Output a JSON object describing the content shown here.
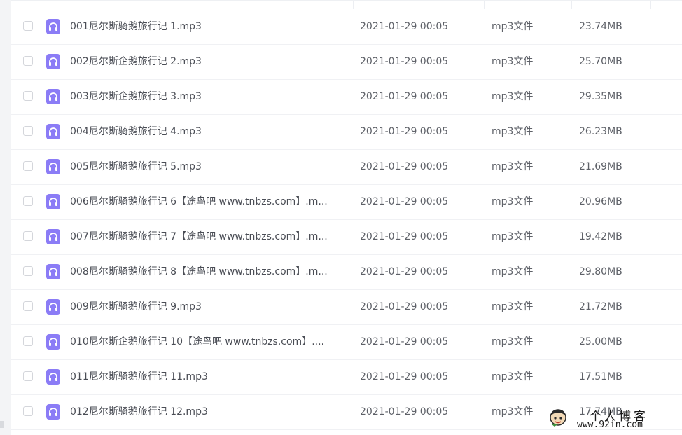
{
  "files": [
    {
      "name": "001尼尔斯骑鹅旅行记 1.mp3",
      "date": "2021-01-29 00:05",
      "type": "mp3文件",
      "size": "23.74MB"
    },
    {
      "name": "002尼尔斯企鹅旅行记 2.mp3",
      "date": "2021-01-29 00:05",
      "type": "mp3文件",
      "size": "25.70MB"
    },
    {
      "name": "003尼尔斯企鹅旅行记 3.mp3",
      "date": "2021-01-29 00:05",
      "type": "mp3文件",
      "size": "29.35MB"
    },
    {
      "name": "004尼尔斯骑鹅旅行记 4.mp3",
      "date": "2021-01-29 00:05",
      "type": "mp3文件",
      "size": "26.23MB"
    },
    {
      "name": "005尼尔斯骑鹅旅行记 5.mp3",
      "date": "2021-01-29 00:05",
      "type": "mp3文件",
      "size": "21.69MB"
    },
    {
      "name": "006尼尔斯骑鹅旅行记 6【途鸟吧 www.tnbzs.com】.m...",
      "date": "2021-01-29 00:05",
      "type": "mp3文件",
      "size": "20.96MB"
    },
    {
      "name": "007尼尔斯骑鹅旅行记 7【途鸟吧 www.tnbzs.com】.m...",
      "date": "2021-01-29 00:05",
      "type": "mp3文件",
      "size": "19.42MB"
    },
    {
      "name": "008尼尔斯骑鹅旅行记 8【途鸟吧 www.tnbzs.com】.m...",
      "date": "2021-01-29 00:05",
      "type": "mp3文件",
      "size": "29.80MB"
    },
    {
      "name": "009尼尔斯骑鹅旅行记 9.mp3",
      "date": "2021-01-29 00:05",
      "type": "mp3文件",
      "size": "21.72MB"
    },
    {
      "name": "010尼尔斯企鹅旅行记 10【途鸟吧 www.tnbzs.com】....",
      "date": "2021-01-29 00:05",
      "type": "mp3文件",
      "size": "25.00MB"
    },
    {
      "name": "011尼尔斯骑鹅旅行记 11.mp3",
      "date": "2021-01-29 00:05",
      "type": "mp3文件",
      "size": "17.51MB"
    },
    {
      "name": "012尼尔斯骑鹅旅行记 12.mp3",
      "date": "2021-01-29 00:05",
      "type": "mp3文件",
      "size": "17.74MB"
    }
  ],
  "watermark": {
    "title": "个人博客",
    "url": "www.92in.com"
  },
  "colors": {
    "icon_bg": "#8b7cf6",
    "text": "#4a4d55"
  }
}
